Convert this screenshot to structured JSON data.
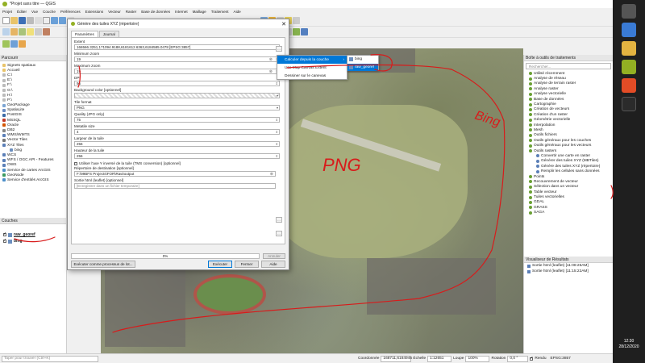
{
  "window": {
    "title": "*Projet sans titre — QGIS"
  },
  "menubar": [
    "Projet",
    "Éditer",
    "Vue",
    "Couche",
    "Préférences",
    "Extensions",
    "Vecteur",
    "Raster",
    "Base de données",
    "Internet",
    "Maillage",
    "Traitement",
    "Aide"
  ],
  "browser": {
    "title": "Parcourir",
    "items": [
      "Signets spatiaux",
      "Accueil",
      "C:\\",
      "E:\\",
      "F:\\",
      "G:\\",
      "H:\\",
      "P:\\",
      "GeoPackage",
      "SpatiaLite",
      "PostGIS",
      "MSSQL",
      "Oracle",
      "DB2",
      "WMS/WMTS",
      "Vector Tiles",
      "XYZ Tiles",
      "bing",
      "WCS",
      "WFS / OGC API - Features",
      "OWS",
      "Service de cartes ArcGIS",
      "GeoNode",
      "Service d'entités ArcGIS"
    ]
  },
  "layers": {
    "title": "Couches",
    "items": [
      {
        "name": "raw_georef",
        "checked": true
      },
      {
        "name": "bing",
        "checked": true
      }
    ]
  },
  "dialog": {
    "title": "Génère des tuiles XYZ (répertoire)",
    "tabs": [
      "Paramètres",
      "Journal"
    ],
    "fields": [
      {
        "label": "Extent",
        "value": "166566.3251,171094.9188,6181612.6363,6184585.0478 [EPSG:3857]",
        "side": "…"
      },
      {
        "label": "Minimum zoom",
        "value": "19"
      },
      {
        "label": "Maximum zoom",
        "value": "19"
      },
      {
        "label": "DPI",
        "value": "96"
      },
      {
        "label": "Background color [optionnel]",
        "value": ""
      },
      {
        "label": "Tile format",
        "value": "PNG"
      },
      {
        "label": "Quality (JPG only)",
        "value": "75"
      },
      {
        "label": "Metatile size",
        "value": "4"
      },
      {
        "label": "Largeur de la tuile",
        "value": "256"
      },
      {
        "label": "Hauteur de la tuile",
        "value": "256"
      }
    ],
    "checkbox": "Utiliser l'axe Y inversé de la tuile  (TMS conversion) [optionnel]",
    "output_dir_label": "Répertoire de destination [optionnel]",
    "output_dir_value": "F:\\99BFS Projects\\FOR\\Raw\\output",
    "html_label": "Sortie html (leaflet) [optionnel]",
    "html_placeholder": "[Enregistrer dans un fichier temporaire]",
    "progress": "0%",
    "progress_fraction": 0,
    "buttons": {
      "batch": "Exécuter comme processus de lot...",
      "run": "Exécuter",
      "close": "Fermer",
      "help": "Aide",
      "cancel": "Annuler"
    }
  },
  "dropdown": {
    "items": [
      "Calculer depuis la couche",
      "Use Map Canvas Extent",
      "Dessiner sur le canevas"
    ],
    "submenu": [
      "bing",
      "raw_georef"
    ]
  },
  "toolbox": {
    "title": "Boîte à outils de traitements",
    "search_placeholder": "Rechercher...",
    "items": [
      "Utilisé récemment",
      "Analyse de réseau",
      "Analyse de terrain raster",
      "Analyse raster",
      "Analyse vectorielle",
      "Base de données",
      "Cartographie",
      "Création de vecteurs",
      "Création d'un raster",
      "Géométrie vectorielle",
      "Interpolation",
      "Mesh",
      "Outils fichiers",
      "Outils généraux pour les couches",
      "Outils généraux pour les vecteurs",
      "Outils rasters",
      "Convertir une carte en raster",
      "Générer des tuiles XYZ (MBTiles)",
      "Génère des tuiles XYZ (répertoire)",
      "Remplir les cellules sans données",
      "Points",
      "Recouvrement de vecteur",
      "Sélection dans un vecteur",
      "Table vecteur",
      "Tuiles vectorielles",
      "GDAL",
      "GRASS",
      "SAGA"
    ]
  },
  "results": {
    "title": "Visualiseur de Résultats",
    "items": [
      "Sortie html (leaflet) [11:08:26AM]",
      "Sortie html (leaflet) [11:15:22AM]"
    ]
  },
  "statusbar": {
    "locator_placeholder": "Taper pour trouver (Ctrl+K)",
    "coord_label": "Coordonnée",
    "coord_value": "168711,6184946",
    "scale_label": "Échelle",
    "scale_value": "1:12651",
    "zoom_label": "Loupe",
    "zoom_value": "100%",
    "rotation_label": "Rotation",
    "rotation_value": "0,0 °",
    "render_label": "Rendu",
    "crs": "EPSG:3857"
  },
  "map_annotations": {
    "png": "PNG",
    "bing": "Bing"
  },
  "clock": {
    "time": "12:30",
    "date": "28/12/2020"
  },
  "colors": {
    "qgis_green": "#93b023",
    "highlight": "#0078d7",
    "annotation_red": "#d81b1b",
    "taskbar": "#1f1f1f"
  }
}
